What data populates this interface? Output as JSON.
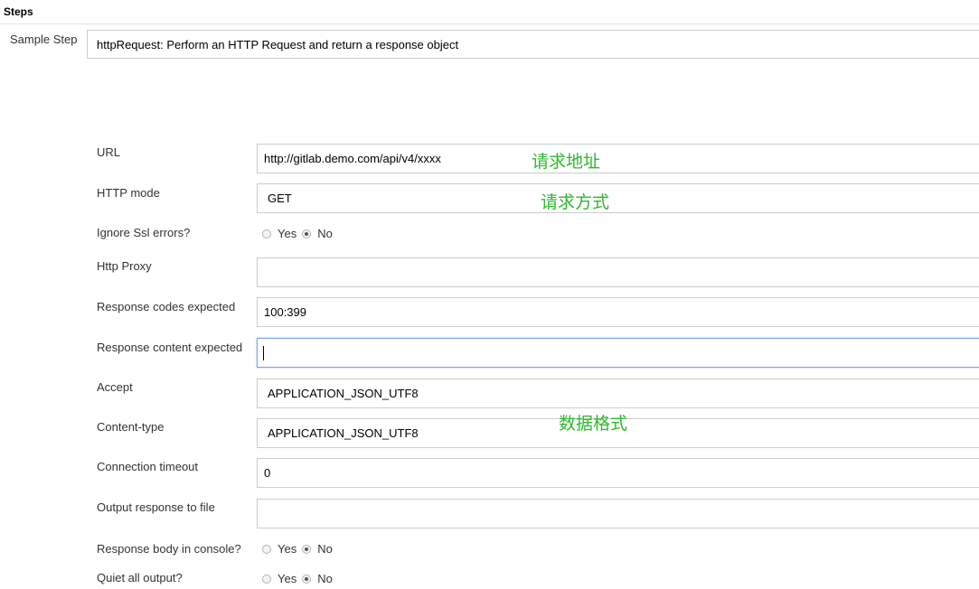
{
  "section": {
    "title": "Steps"
  },
  "sample_step": {
    "label": "Sample Step",
    "selected": "httpRequest: Perform an HTTP Request and return a response object"
  },
  "fields": {
    "url": {
      "label": "URL",
      "value": "http://gitlab.demo.com/api/v4/xxxx"
    },
    "http_mode": {
      "label": "HTTP mode",
      "value": "GET"
    },
    "ignore_ssl": {
      "label": "Ignore Ssl errors?",
      "yes": "Yes",
      "no": "No",
      "selected": "No"
    },
    "http_proxy": {
      "label": "Http Proxy",
      "value": ""
    },
    "response_codes": {
      "label": "Response codes expected",
      "value": "100:399"
    },
    "response_content": {
      "label": "Response content expected",
      "value": ""
    },
    "accept": {
      "label": "Accept",
      "value": "APPLICATION_JSON_UTF8"
    },
    "content_type": {
      "label": "Content-type",
      "value": "APPLICATION_JSON_UTF8"
    },
    "connection_timeout": {
      "label": "Connection timeout",
      "value": "0"
    },
    "output_file": {
      "label": "Output response to file",
      "value": ""
    },
    "body_console": {
      "label": "Response body in console?",
      "yes": "Yes",
      "no": "No",
      "selected": "No"
    },
    "quiet_output": {
      "label": "Quiet all output?",
      "yes": "Yes",
      "no": "No",
      "selected": "No"
    }
  },
  "annotations": {
    "url_note": "请求地址",
    "mode_note": "请求方式",
    "format_note": "数据格式"
  },
  "colors": {
    "annotation": "#2eb82e",
    "focus_border": "#7aa6e6",
    "field_border": "#cccccc"
  }
}
